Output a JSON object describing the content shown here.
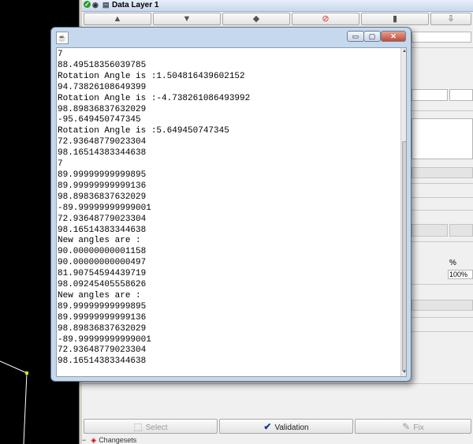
{
  "layer_panel": {
    "title": "Data Layer 1"
  },
  "console_window": {
    "title": "",
    "controls": {
      "minimize": "▭",
      "maximize": "▢",
      "close": "✕"
    },
    "lines": [
      "7",
      "88.49518356039785",
      "Rotation Angle is :1.504816439602152",
      "94.73826108649399",
      "Rotation Angle is :-4.738261086493992",
      "98.89836837632029",
      "-95.649450747345",
      "Rotation Angle is :5.649450747345",
      "72.93648779023304",
      "98.16514383344638",
      "7",
      "89.99999999999895",
      "89.99999999999136",
      "98.89836837632029",
      "-89.99999999999001",
      "72.93648779023304",
      "98.16514383344638",
      "New angles are :",
      "90.00000000001158",
      "90.00000000000497",
      "81.90754594439719",
      "98.09245405558626",
      "New angles are :",
      "89.99999999999895",
      "89.99999999999136",
      "98.89836837632029",
      "-89.99999999999001",
      "72.93648779023304",
      "98.16514383344638"
    ]
  },
  "table": {
    "percent_header": "%",
    "percent_value": "100%"
  },
  "bottom_buttons": {
    "select": "Select",
    "validation": "Validation",
    "fix": "Fix"
  },
  "status": {
    "label": "Changesets"
  },
  "colors": {
    "canvas_bg": "#000000",
    "canvas_line": "#ffffff",
    "canvas_node": "#e0e000",
    "window_frame": "#c6d8ec",
    "close_button": "#c24a35"
  },
  "icons": {
    "layer_check": "check-icon",
    "visibility": "eye-icon",
    "validation": "checkmark-icon",
    "select": "select-icon",
    "fix": "wrench-icon",
    "changesets": "changesets-icon",
    "java": "java-icon"
  }
}
